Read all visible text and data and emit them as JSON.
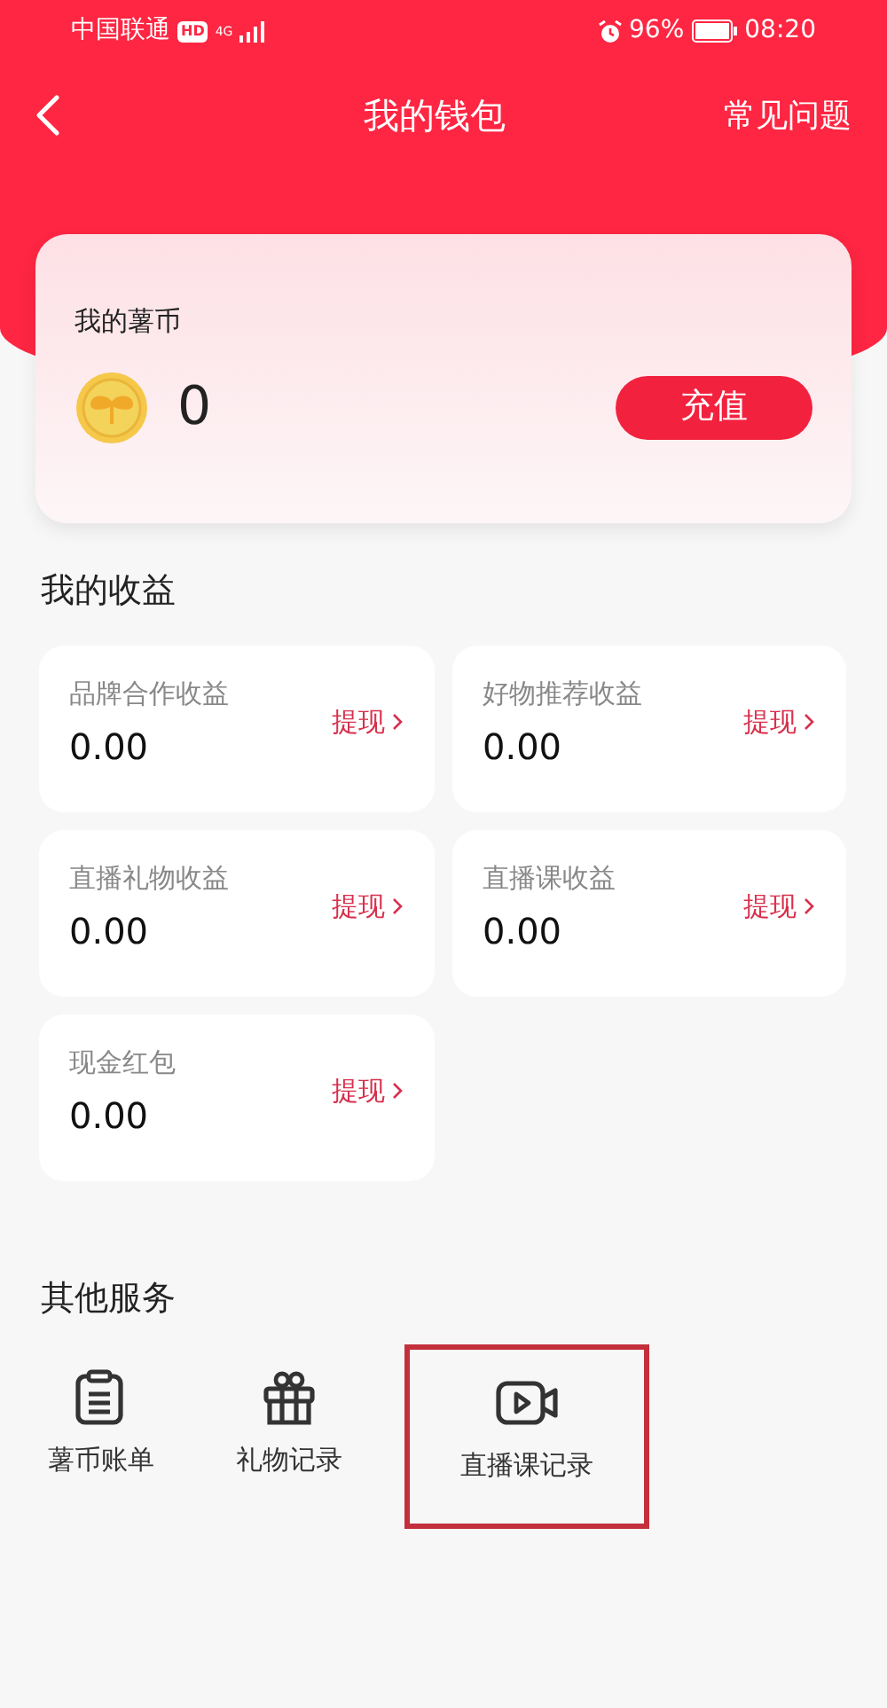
{
  "status_bar": {
    "carrier": "中国联通",
    "hd": "HD",
    "network": "4G",
    "battery": "96%",
    "time": "08:20"
  },
  "nav": {
    "title": "我的钱包",
    "action": "常见问题"
  },
  "coins": {
    "label": "我的薯币",
    "amount": "0",
    "button": "充值"
  },
  "earnings": {
    "title": "我的收益",
    "items": [
      {
        "label": "品牌合作收益",
        "value": "0.00",
        "action": "提现"
      },
      {
        "label": "好物推荐收益",
        "value": "0.00",
        "action": "提现"
      },
      {
        "label": "直播礼物收益",
        "value": "0.00",
        "action": "提现"
      },
      {
        "label": "直播课收益",
        "value": "0.00",
        "action": "提现"
      },
      {
        "label": "现金红包",
        "value": "0.00",
        "action": "提现"
      }
    ]
  },
  "services": {
    "title": "其他服务",
    "items": [
      {
        "kind": "bill",
        "label": "薯币账单",
        "highlighted": false
      },
      {
        "kind": "gift",
        "label": "礼物记录",
        "highlighted": false
      },
      {
        "kind": "video",
        "label": "直播课记录",
        "highlighted": true
      }
    ]
  }
}
